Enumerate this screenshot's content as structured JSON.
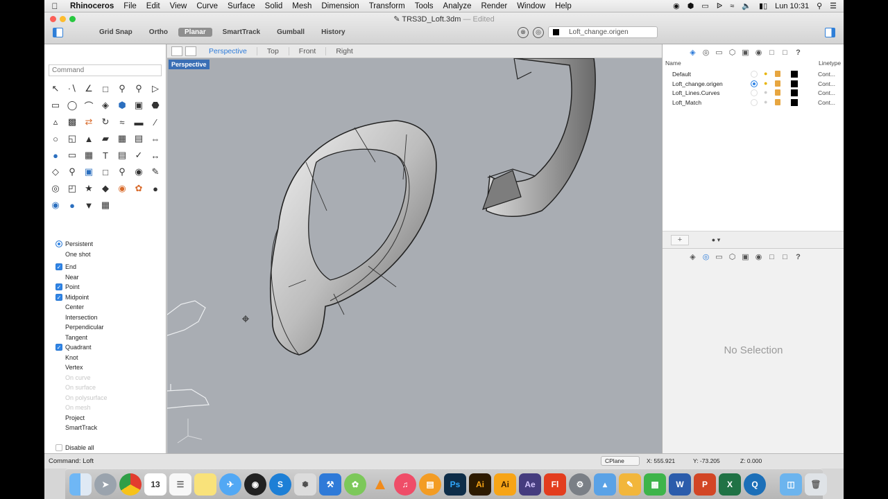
{
  "menubar": {
    "app": "Rhinoceros",
    "items": [
      "File",
      "Edit",
      "View",
      "Curve",
      "Surface",
      "Solid",
      "Mesh",
      "Dimension",
      "Transform",
      "Tools",
      "Analyze",
      "Render",
      "Window",
      "Help"
    ],
    "clock": "Lun 10:31"
  },
  "window": {
    "title": "TRS3D_Loft.3dm",
    "edited": "— Edited"
  },
  "toolbar": {
    "modes": [
      "Grid Snap",
      "Ortho",
      "Planar",
      "SmartTrack",
      "Gumball",
      "History"
    ],
    "active_mode": "Planar",
    "current_layer": "Loft_change.origen"
  },
  "command": {
    "placeholder": "Command",
    "status": "Command: Loft"
  },
  "tools": {
    "icons": [
      "select-arrow",
      "point",
      "polyline",
      "rectangle-select",
      "zoom-window",
      "zoom-dynamic",
      "play-arrow",
      "rectangle",
      "circle",
      "arc",
      "surface",
      "solid-loft",
      "box",
      "boolean",
      "cylinder",
      "mesh",
      "transform",
      "bend",
      "curve-tools",
      "shell",
      "split",
      "pipe",
      "fillet-edge",
      "extrude",
      "offset",
      "cage",
      "array",
      "mirror",
      "cylinder-blue",
      "mesh-plane",
      "grid",
      "text",
      "clipboard",
      "checkmark",
      "dimension",
      "layer-tool",
      "zoom",
      "capture",
      "scale",
      "magnifier",
      "camera",
      "line-edit",
      "lens",
      "scale-tool",
      "lamp",
      "gem",
      "render",
      "color-wheel",
      "sphere",
      "analyze-globe",
      "earth",
      "filter",
      "grid-tool"
    ],
    "count": 53
  },
  "osnaps": {
    "mode_persistent": "Persistent",
    "mode_oneshot": "One shot",
    "items": [
      {
        "label": "End",
        "checked": true,
        "enabled": true
      },
      {
        "label": "Near",
        "checked": false,
        "enabled": true
      },
      {
        "label": "Point",
        "checked": true,
        "enabled": true
      },
      {
        "label": "Midpoint",
        "checked": true,
        "enabled": true
      },
      {
        "label": "Center",
        "checked": false,
        "enabled": true
      },
      {
        "label": "Intersection",
        "checked": false,
        "enabled": true
      },
      {
        "label": "Perpendicular",
        "checked": false,
        "enabled": true
      },
      {
        "label": "Tangent",
        "checked": false,
        "enabled": true
      },
      {
        "label": "Quadrant",
        "checked": true,
        "enabled": true
      },
      {
        "label": "Knot",
        "checked": false,
        "enabled": true
      },
      {
        "label": "Vertex",
        "checked": false,
        "enabled": true
      },
      {
        "label": "On curve",
        "checked": false,
        "enabled": false
      },
      {
        "label": "On surface",
        "checked": false,
        "enabled": false
      },
      {
        "label": "On polysurface",
        "checked": false,
        "enabled": false
      },
      {
        "label": "On mesh",
        "checked": false,
        "enabled": false
      },
      {
        "label": "Project",
        "checked": false,
        "enabled": true
      },
      {
        "label": "SmartTrack",
        "checked": false,
        "enabled": true
      }
    ],
    "disable_all": "Disable all"
  },
  "viewport": {
    "tabs": [
      "Perspective",
      "Top",
      "Front",
      "Right"
    ],
    "active": "Perspective",
    "label": "Perspective"
  },
  "layers": {
    "header_name": "Name",
    "header_linetype": "Linetype",
    "rows": [
      {
        "name": "Default",
        "current": false,
        "on": true,
        "linetype": "Cont..."
      },
      {
        "name": "Loft_change.origen",
        "current": true,
        "on": true,
        "linetype": "Cont..."
      },
      {
        "name": "Loft_Lines.Curves",
        "current": false,
        "on": false,
        "linetype": "Cont..."
      },
      {
        "name": "Loft_Match",
        "current": false,
        "on": false,
        "linetype": "Cont..."
      }
    ],
    "add_label": "+"
  },
  "properties": {
    "empty_text": "No Selection"
  },
  "statusbar": {
    "cplane": "CPlane",
    "x": "X: 555.921",
    "y": "Y: -73.205",
    "z": "Z: 0.000"
  },
  "dock": {
    "apps": [
      "Finder",
      "Launchpad",
      "Chrome",
      "Calendar",
      "TextEdit",
      "Notes",
      "Messages",
      "Camera",
      "Skype",
      "Rhino",
      "Xcode",
      "Maps",
      "VLC",
      "iTunes",
      "iBooks",
      "Photoshop",
      "Illustrator",
      "Illustrator 2",
      "After Effects",
      "Flash",
      "System Preferences",
      "Keynote",
      "Pages",
      "Numbers",
      "Word",
      "PowerPoint",
      "Excel",
      "QuickTime",
      "Folder",
      "Trash"
    ],
    "labels": {
      "ps": "Ps",
      "ai": "Ai",
      "ae": "Ae",
      "fl": "Fl",
      "cal": "13",
      "w": "W",
      "x": "X",
      "p": "P"
    },
    "colors": {
      "ps": "#0e2d48",
      "ai": "#2d1a00",
      "ai2": "#f7a416",
      "ae": "#453c7e",
      "fl": "#e33d1e"
    }
  },
  "accent_color": "#2b7ad9"
}
